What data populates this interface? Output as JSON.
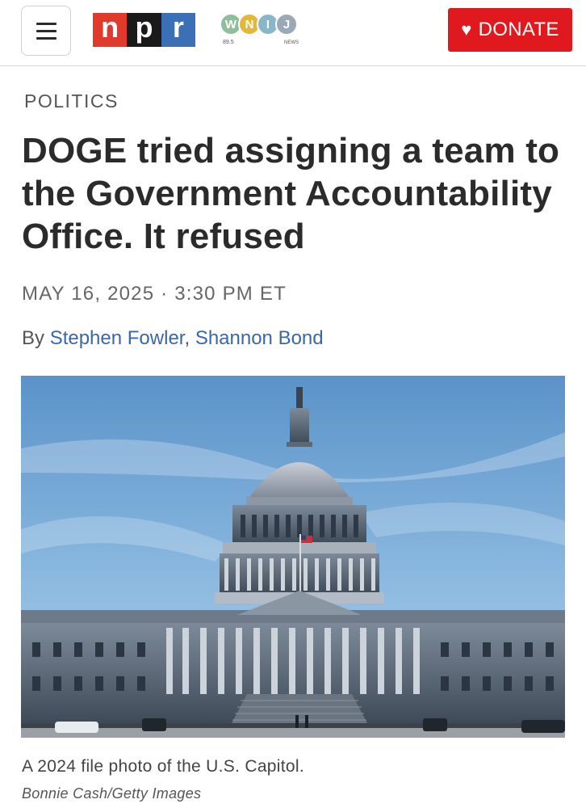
{
  "header": {
    "menu_icon": "hamburger-menu-icon",
    "npr_letters": [
      "n",
      "p",
      "r"
    ],
    "station_letters": [
      "W",
      "N",
      "I",
      "J"
    ],
    "station_frequency": "89.5",
    "station_tag": "NEWS",
    "donate_icon": "heart-icon",
    "donate_label": "DONATE",
    "colors": {
      "npr_red": "#e03a2c",
      "npr_black": "#1a1a1a",
      "npr_blue": "#3b6fb6",
      "donate_bg": "#e0191f"
    }
  },
  "article": {
    "section": "POLITICS",
    "headline": "DOGE tried assigning a team to the Government Accountability Office. It refused",
    "date": "MAY 16, 2025 · 3:30 PM ET",
    "byline_prefix": "By ",
    "authors": [
      "Stephen Fowler",
      "Shannon Bond"
    ],
    "author_separator": ", ",
    "image": {
      "caption": "A 2024 file photo of the U.S. Capitol.",
      "credit": "Bonnie Cash/Getty Images"
    }
  }
}
